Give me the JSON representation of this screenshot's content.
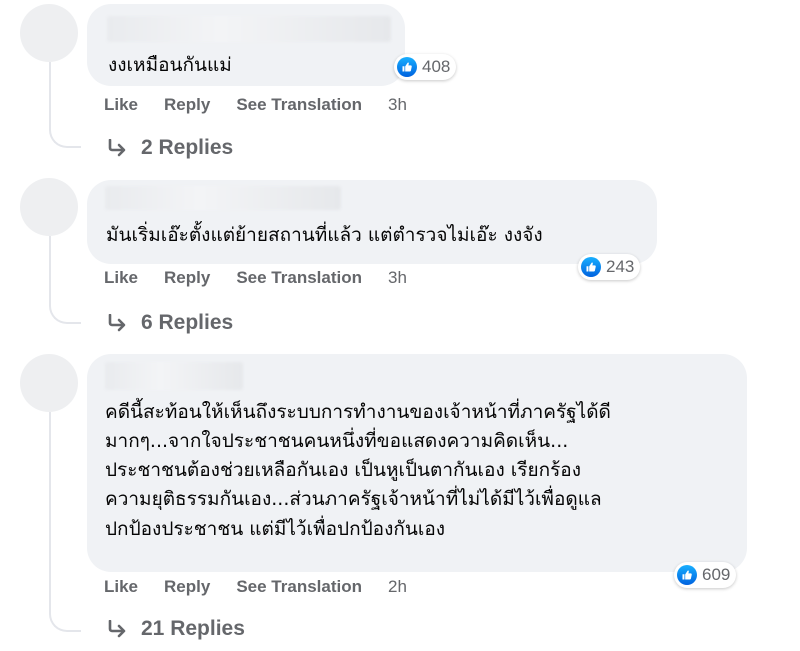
{
  "comments": [
    {
      "text_lines": [
        "งงเหมือนกันแม่"
      ],
      "reactions": {
        "count": "408",
        "icon": "like-icon"
      },
      "actions": {
        "like": "Like",
        "reply": "Reply",
        "translate": "See Translation",
        "time": "3h"
      },
      "replies_label": "2 Replies"
    },
    {
      "text_lines": [
        "มันเริ่มเอ๊ะตั้งแต่ย้ายสถานที่แล้ว แต่ตำรวจไม่เอ๊ะ งงจัง"
      ],
      "reactions": {
        "count": "243",
        "icon": "like-icon"
      },
      "actions": {
        "like": "Like",
        "reply": "Reply",
        "translate": "See Translation",
        "time": "3h"
      },
      "replies_label": "6 Replies"
    },
    {
      "text_lines": [
        "คดีนี้สะท้อนให้เห็นถึงระบบการทำงานของเจ้าหน้าที่ภาครัฐได้ดี",
        "มากๆ...จากใจประชาชนคนหนึ่งที่ขอแสดงความคิดเห็น...",
        "ประชาชนต้องช่วยเหลือกันเอง เป็นหูเป็นตากันเอง เรียกร้อง",
        "ความยุติธรรมกันเอง...ส่วนภาครัฐเจ้าหน้าที่ไม่ได้มีไว้เพื่อดูแล",
        "ปกป้องประชาชน แต่มีไว้เพื่อปกป้องกันเอง"
      ],
      "reactions": {
        "count": "609",
        "icon": "like-icon"
      },
      "actions": {
        "like": "Like",
        "reply": "Reply",
        "translate": "See Translation",
        "time": "2h"
      },
      "replies_label": "21 Replies"
    }
  ],
  "colors": {
    "bubble": "#f0f2f5",
    "secondary_text": "#65676b",
    "like_blue": "#0866ff"
  }
}
